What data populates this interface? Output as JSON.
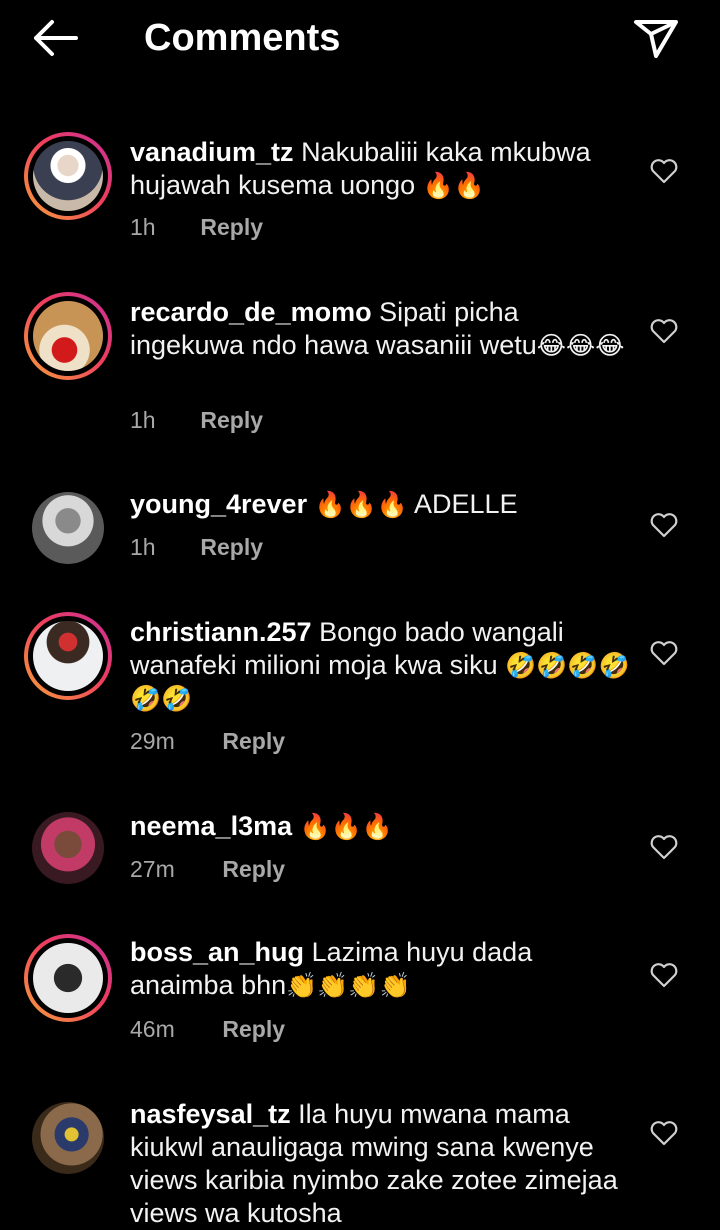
{
  "header": {
    "title": "Comments",
    "back_icon": "back-arrow-icon",
    "share_icon": "send-icon"
  },
  "reply_label": "Reply",
  "comments": [
    {
      "username": "vanadium_tz",
      "text": "Nakubaliii kaka mkubwa hujawah kusema uongo",
      "emoji": "🔥🔥",
      "time": "1h"
    },
    {
      "username": "recardo_de_momo",
      "text": "Sipati picha ingekuwa ndo hawa wasaniii wetu",
      "emoji": "😂😂😂",
      "time": "1h"
    },
    {
      "username": "young_4rever",
      "text": "ADELLE",
      "emoji": "🔥🔥🔥",
      "time": "1h"
    },
    {
      "username": "christiann.257",
      "text": "Bongo bado wangali wanafeki milioni moja kwa siku",
      "emoji": "🤣🤣🤣🤣🤣🤣",
      "time": "29m"
    },
    {
      "username": "neema_l3ma",
      "text": "",
      "emoji": "🔥🔥🔥",
      "time": "27m"
    },
    {
      "username": "boss_an_hug",
      "text": "Lazima huyu dada anaimba bhn",
      "emoji": "👏👏👏👏",
      "time": "46m"
    },
    {
      "username": "nasfeysal_tz",
      "text": "Ila huyu mwana mama kiukwl anauligaga mwing sana kwenye views karibia nyimbo zake zotee zimejaa views wa kutosha",
      "emoji": "",
      "time": ""
    }
  ],
  "colors": {
    "background": "#000000",
    "secondary_text": "#a8a8a8",
    "ring_start": "#f9a23b",
    "ring_end": "#c62f9a"
  }
}
